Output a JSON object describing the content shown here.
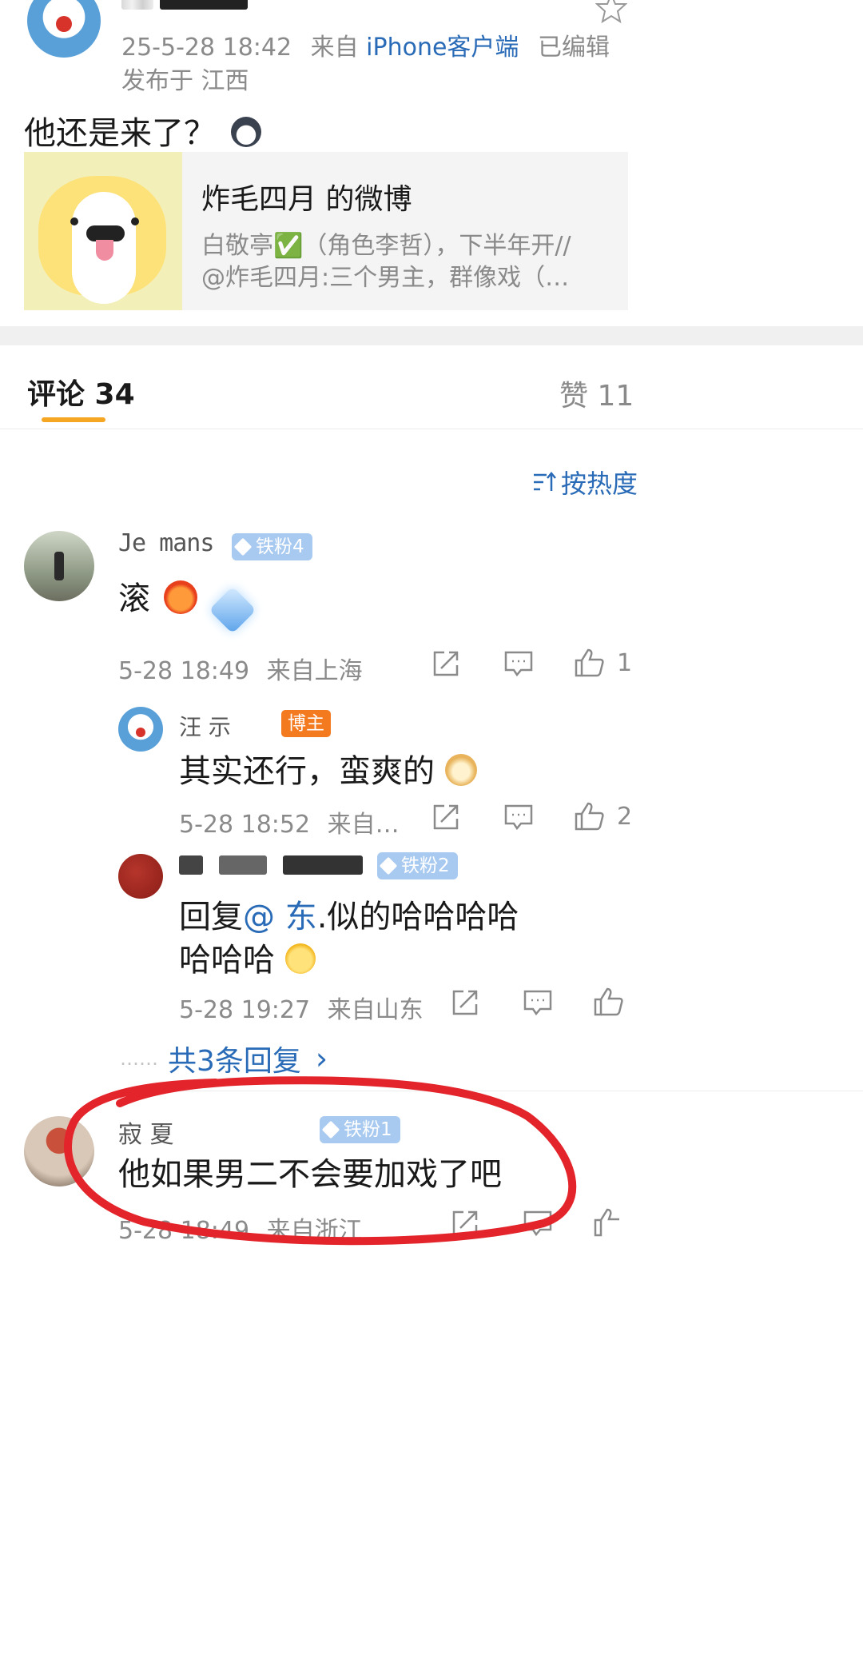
{
  "post": {
    "timestamp": "25-5-28 18:42",
    "source_prefix": "来自",
    "source_app": "iPhone客户端",
    "edited": "已编辑",
    "location": "发布于 江西",
    "text": "他还是来了？",
    "shared": {
      "title": "炸毛四月 的微博",
      "excerpt_line1": "白敬亭✅（角色李哲），下半年开//",
      "excerpt_line2": "@炸毛四月:三个男主，群像戏（…"
    }
  },
  "tabs": {
    "comments_label": "评论 34",
    "likes_label": "赞 11"
  },
  "sort": {
    "label": "按热度"
  },
  "comments": [
    {
      "username_visible": "Je    mans",
      "badge": "铁粉4",
      "text": "滚",
      "time": "5-28 18:49",
      "location": "来自上海",
      "like_count": "1"
    },
    {
      "username_visible": "汪  示",
      "badge": "博主",
      "text": "其实还行，蛮爽的",
      "time": "5-28 18:52",
      "location": "来自…",
      "like_count": "2"
    },
    {
      "badge": "铁粉2",
      "text_prefix": "回复",
      "mention": "@    东",
      "text_rest": ".似的哈哈哈哈",
      "text_line2": "哈哈哈",
      "time": "5-28 19:27",
      "location": "来自山东"
    },
    {
      "username_visible": "寂  夏",
      "badge": "铁粉1",
      "text": "他如果男二不会要加戏了吧",
      "time": "5-28 18:49",
      "location": "来自浙江"
    }
  ],
  "more_replies": {
    "dots": "……",
    "label": "共3条回复",
    "arrow": "›"
  },
  "colors": {
    "link_blue": "#2a6bb7",
    "tab_indicator": "#f5a623",
    "meta_gray": "#8a8a8a",
    "annotation_red": "#e3242b",
    "badge_blue": "#a8c9f0",
    "badge_orange": "#f47a20"
  },
  "icons": [
    "star-icon",
    "verified-check-icon",
    "sort-icon",
    "share-icon",
    "comment-icon",
    "like-icon",
    "chevron-right-icon"
  ]
}
